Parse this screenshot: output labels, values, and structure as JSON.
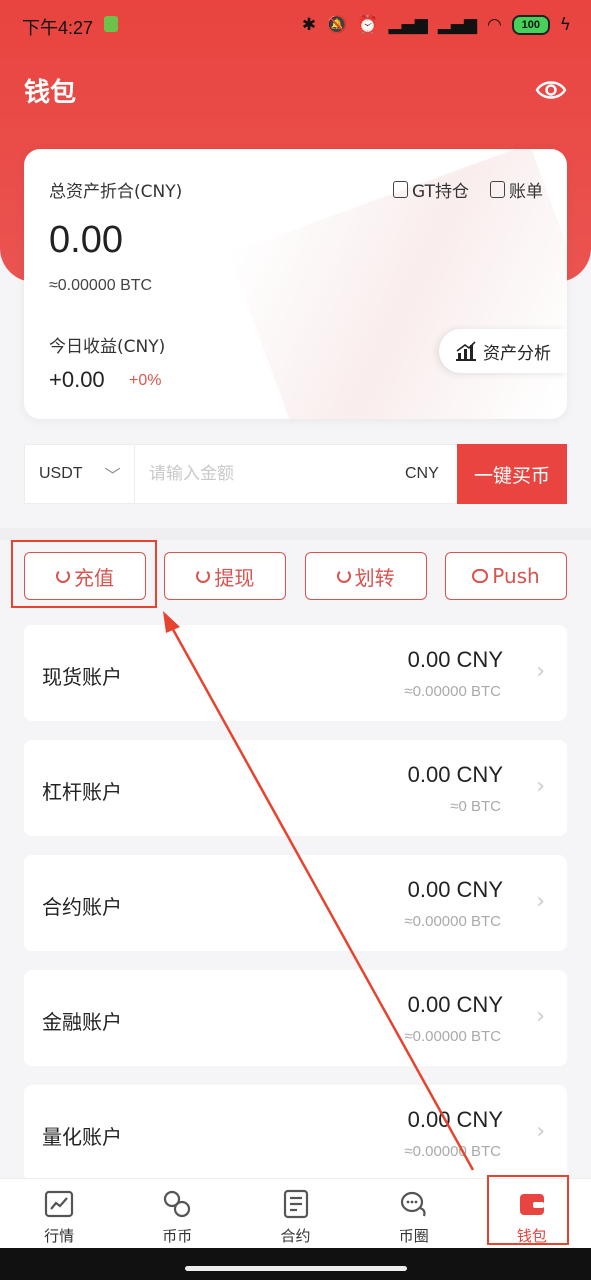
{
  "status_bar": {
    "time": "下午4:27",
    "battery": "100"
  },
  "header": {
    "title": "钱包"
  },
  "asset_card": {
    "total_label": "总资产折合(CNY)",
    "gt_holdings_label": "GT持仓",
    "bill_label": "账单",
    "total_value": "0.00",
    "btc_value": "≈0.00000 BTC",
    "today_label": "今日收益(CNY)",
    "today_value": "+0.00",
    "today_percent": "+0%",
    "analysis_label": "资产分析"
  },
  "buy_row": {
    "currency": "USDT",
    "amount_placeholder": "请输入金额",
    "unit": "CNY",
    "button_label": "一键买币"
  },
  "actions": [
    {
      "label": "充值"
    },
    {
      "label": "提现"
    },
    {
      "label": "划转"
    },
    {
      "label": "Push"
    }
  ],
  "accounts": [
    {
      "name": "现货账户",
      "amount": "0.00 CNY",
      "btc": "≈0.00000 BTC"
    },
    {
      "name": "杠杆账户",
      "amount": "0.00 CNY",
      "btc": "≈0 BTC"
    },
    {
      "name": "合约账户",
      "amount": "0.00 CNY",
      "btc": "≈0.00000 BTC"
    },
    {
      "name": "金融账户",
      "amount": "0.00 CNY",
      "btc": "≈0.00000 BTC"
    },
    {
      "name": "量化账户",
      "amount": "0.00 CNY",
      "btc": "≈0.00000 BTC"
    }
  ],
  "bottom_nav": [
    {
      "label": "行情",
      "icon": "market-chart-icon"
    },
    {
      "label": "币币",
      "icon": "exchange-icon"
    },
    {
      "label": "合约",
      "icon": "contract-icon"
    },
    {
      "label": "币圈",
      "icon": "community-chat-icon"
    },
    {
      "label": "钱包",
      "icon": "wallet-icon",
      "active": true
    }
  ],
  "colors": {
    "brand_red": "#e9443f",
    "annotation_red": "#e8432e"
  }
}
